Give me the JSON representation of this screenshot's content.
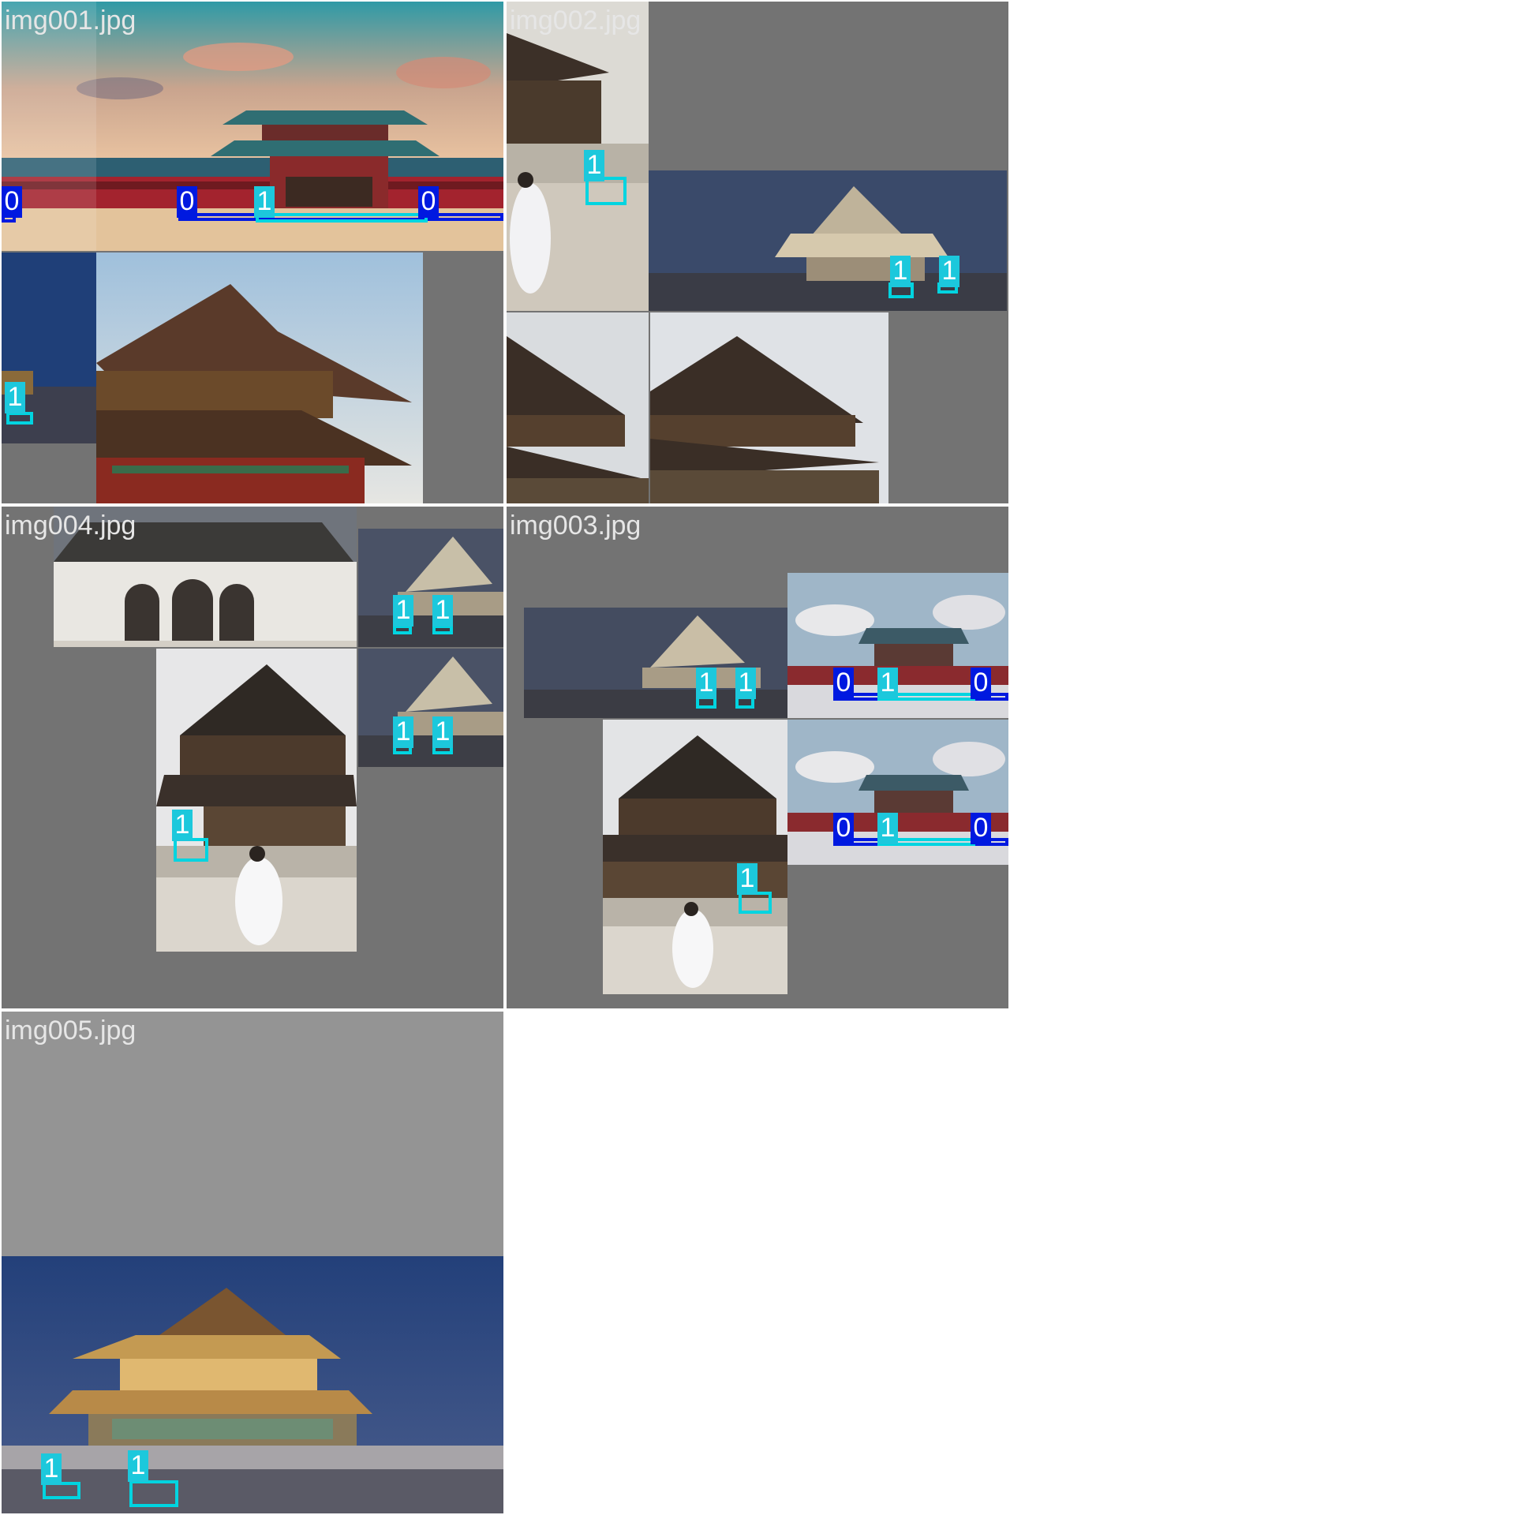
{
  "tiles": [
    {
      "label": "img001.jpg"
    },
    {
      "label": "img002.jpg"
    },
    {
      "label": "img004.jpg"
    },
    {
      "label": "img003.jpg"
    },
    {
      "label": "img005.jpg"
    }
  ],
  "class_tags": {
    "zero": "0",
    "one": "1"
  },
  "colors": {
    "class_0": "#0019e0",
    "class_1": "#00d4e0",
    "padding_gray": "#737373",
    "padding_light": "#949494",
    "label_text": "#e6e6e6"
  }
}
